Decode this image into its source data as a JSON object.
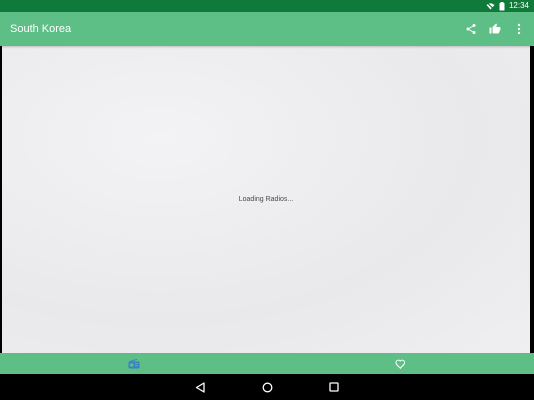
{
  "status_bar": {
    "time": "12:34",
    "wifi_icon": "wifi-off-icon",
    "battery_icon": "battery-icon"
  },
  "app_bar": {
    "title": "South Korea",
    "actions": [
      "share-icon",
      "thumbs-up-icon",
      "more-vert-icon"
    ]
  },
  "content": {
    "loading_text": "Loading Radios..."
  },
  "bottom_tabs": {
    "items": [
      {
        "icon": "radio-icon",
        "selected": true
      },
      {
        "icon": "heart-icon",
        "selected": false
      }
    ]
  },
  "nav_bar": {
    "items": [
      "back-icon",
      "home-icon",
      "recents-icon"
    ]
  },
  "colors": {
    "status_bar": "#0f7a3a",
    "primary": "#5dbe86",
    "selected_tab_icon": "#3b82c4",
    "background": "#ececef"
  }
}
